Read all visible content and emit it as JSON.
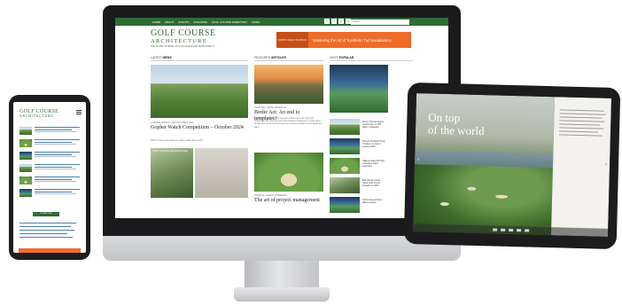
{
  "desktop": {
    "nav_items": [
      "HOME",
      "ABOUT",
      "EVENTS",
      "MAGAZINE",
      "GOLF COURSE DIRECTORY",
      "MORE"
    ],
    "social_icons": [
      "x-icon",
      "facebook-icon",
      "linkedin-icon",
      "instagram-icon"
    ],
    "search_placeholder": "Search",
    "logo_line1": "GOLF COURSE",
    "logo_line2": "ARCHITECTURE",
    "logo_tagline": "THE GLOBAL JOURNAL OF GOLF DESIGN AND DEVELOPMENT",
    "ad_logo": "SPORTS FIELD HOLDINGS",
    "ad_text": "Mastering the Art of Synthetic Turf Installations",
    "col_latest_prefix": "LATEST",
    "col_latest_word": "NEWS",
    "col_featured_prefix": "FEATURED",
    "col_featured_word": "ARTICLES",
    "col_popular_prefix": "MOST",
    "col_popular_word": "POPULAR",
    "news_caption": "GOPHER WATCH • 18th OCTOBER 2024",
    "news_headline": "Gopher Watch Competition – October 2024",
    "news_para": "Which course has hosted the gopher earlier this month?",
    "news2_caption": "GOLF COURSE ARCHITECTURE",
    "feat_caption": "FEATURE • KEVIN MARKHAM",
    "feat_headline": "Birdie Act: An end to templates?",
    "feat_para": "Legislation before the US Congress would extend the copyright protections that currently cover the buildings architecture to golf course design. But would that protection be a course of action? Kevin Markham asks...",
    "feat2_caption": "OPINION • ADAM LAWRENCE",
    "feat2_headline": "The art of project management",
    "popular": [
      "Ebony Thomas begins construction on Cliff Dale in Nebraska",
      "Second historical Trump Turnberry to open in summer 2025",
      "Gilgeous Eleventh Hole renovation plans submitted",
      "Bob Van Der Velde News Links to host Invitation in 2025",
      "Golf course architect plans unveiled"
    ]
  },
  "phone": {
    "logo_line1": "GOLF COURSE",
    "logo_line2": "ARCHITECTURE",
    "button": "DOWNLOAD"
  },
  "tablet": {
    "mag_title_line1": "On top",
    "mag_title_line2": "of the world"
  }
}
